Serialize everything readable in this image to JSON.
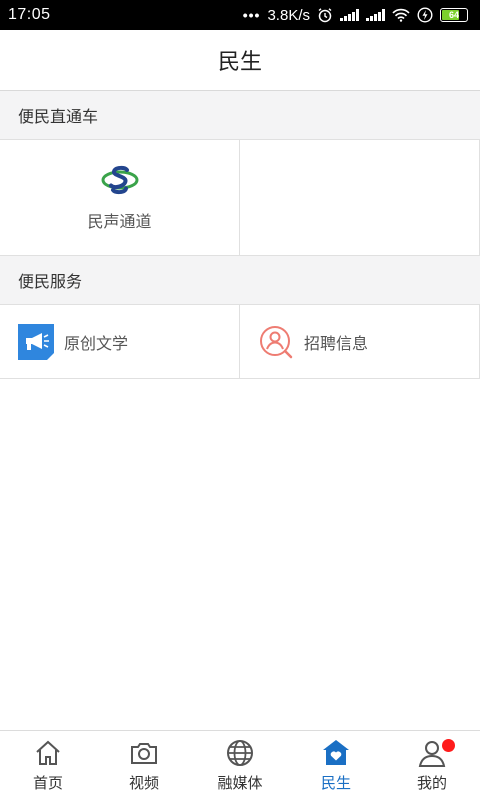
{
  "status_bar": {
    "time": "17:05",
    "dots": "•••",
    "speed": "3.8K/s",
    "battery": "64"
  },
  "header": {
    "title": "民生"
  },
  "sections": [
    {
      "title": "便民直通车",
      "items": [
        {
          "label": "民声通道",
          "icon": "minsheng-logo-icon"
        }
      ]
    },
    {
      "title": "便民服务",
      "items": [
        {
          "label": "原创文学",
          "icon": "megaphone-icon"
        },
        {
          "label": "招聘信息",
          "icon": "person-search-icon"
        }
      ]
    }
  ],
  "bottom_nav": [
    {
      "label": "首页",
      "icon": "home-icon"
    },
    {
      "label": "视频",
      "icon": "camera-icon"
    },
    {
      "label": "融媒体",
      "icon": "globe-icon"
    },
    {
      "label": "民生",
      "icon": "heart-house-icon",
      "active": true
    },
    {
      "label": "我的",
      "icon": "user-icon",
      "badge": true
    }
  ],
  "colors": {
    "accent": "#1a6fc4",
    "badge": "#ff1b1b",
    "section_bg": "#f4f4f5"
  }
}
